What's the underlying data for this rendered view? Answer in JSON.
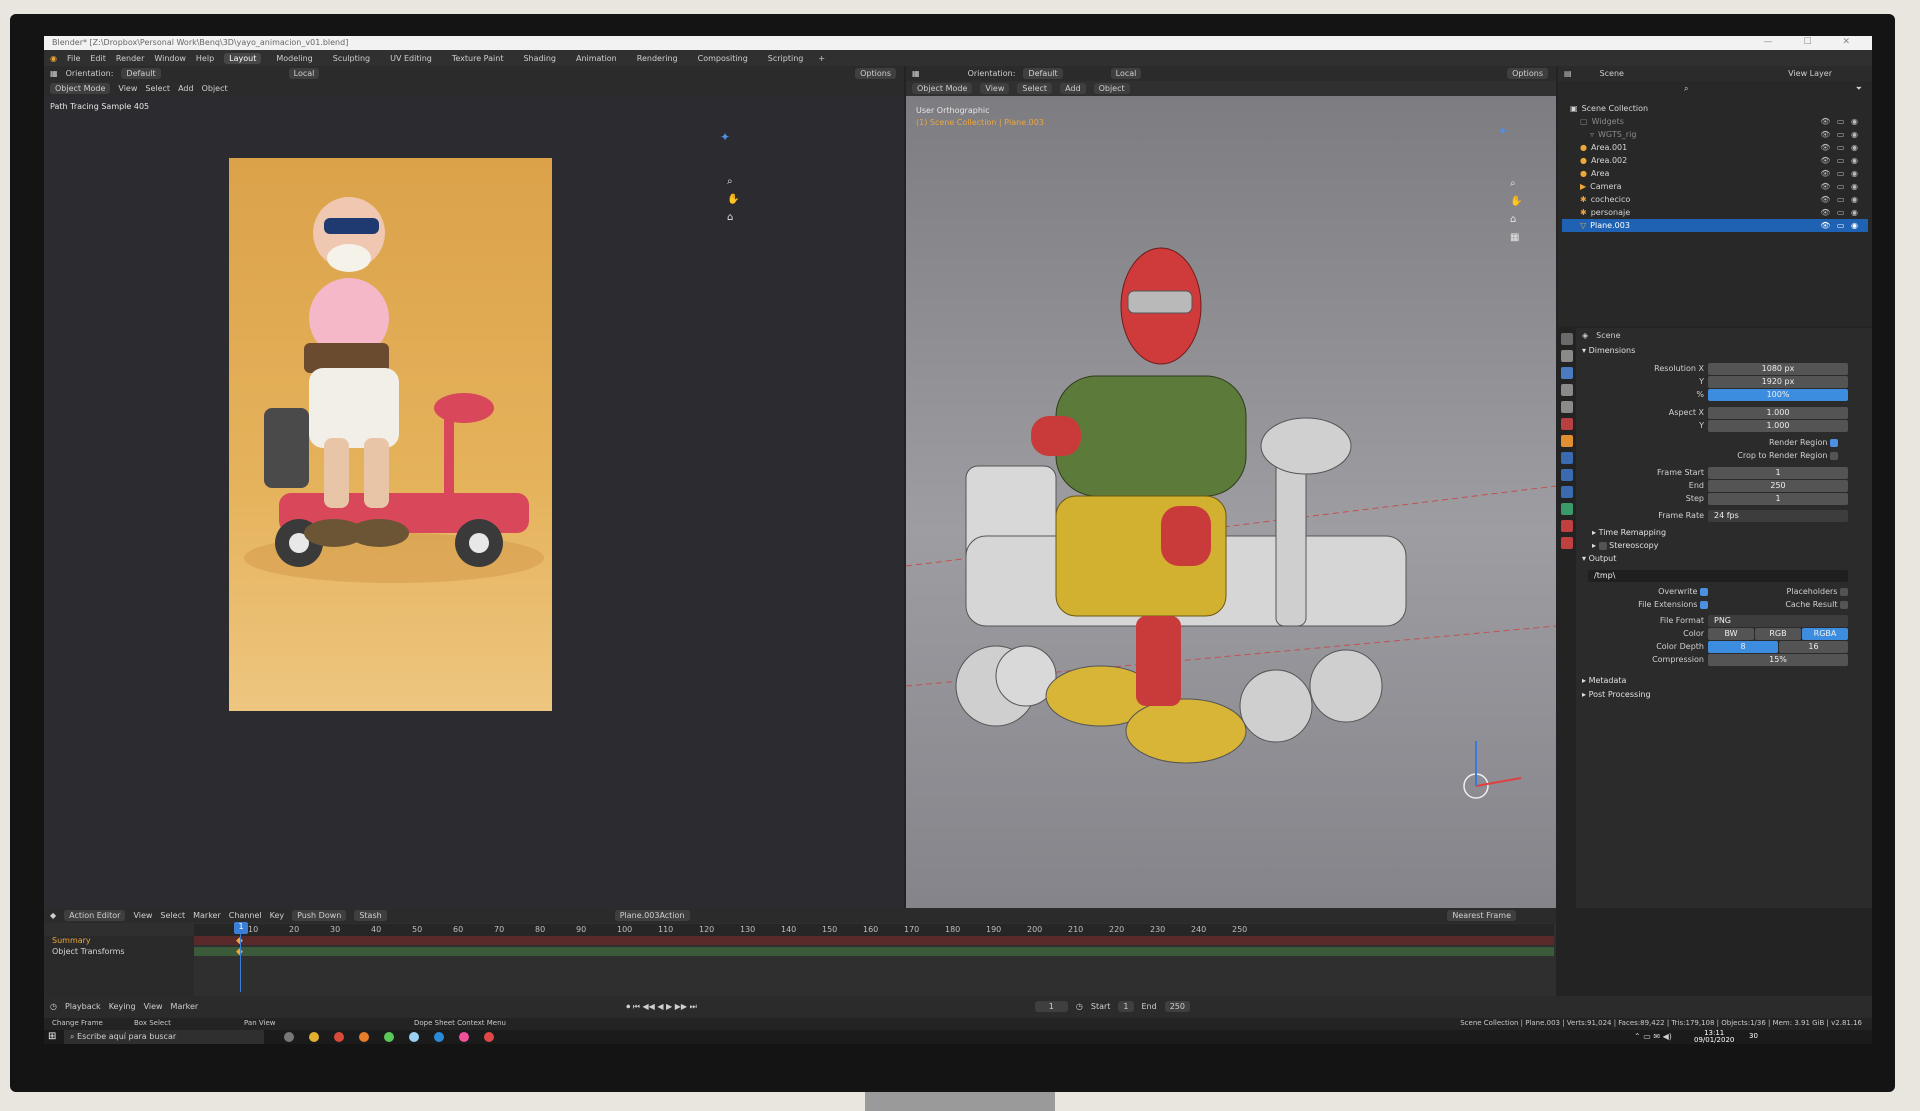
{
  "titlebar": {
    "text": "Blender* [Z:\\Dropbox\\Personal Work\\Benq\\3D\\yayo_animacion_v01.blend]"
  },
  "menu": [
    "File",
    "Edit",
    "Render",
    "Window",
    "Help"
  ],
  "workspaces": [
    "Layout",
    "Modeling",
    "Sculpting",
    "UV Editing",
    "Texture Paint",
    "Shading",
    "Animation",
    "Rendering",
    "Compositing",
    "Scripting"
  ],
  "active_workspace": "Layout",
  "render_view": {
    "orientation_label": "Orientation:",
    "orientation_value": "Default",
    "pivot": "Local",
    "options": "Options",
    "mode": "Object Mode",
    "menus": [
      "View",
      "Select",
      "Add",
      "Object"
    ],
    "sample_text": "Path Tracing Sample 405"
  },
  "viewport": {
    "mode": "Object Mode",
    "menus": [
      "View",
      "Select",
      "Add",
      "Object"
    ],
    "orientation_label": "Orientation:",
    "orientation_value": "Default",
    "pivot": "Local",
    "options": "Options",
    "view_name": "User Orthographic",
    "collection_path": "(1) Scene Collection | Plane.003"
  },
  "outliner": {
    "scene_label": "Scene",
    "view_layer_label": "View Layer",
    "rows": [
      {
        "label": "Scene Collection",
        "selected": false,
        "indent": 0
      },
      {
        "label": "Widgets",
        "selected": false,
        "indent": 1
      },
      {
        "label": "WGTS_rig",
        "selected": false,
        "indent": 2
      },
      {
        "label": "Area.001",
        "selected": false,
        "indent": 1
      },
      {
        "label": "Area.002",
        "selected": false,
        "indent": 1
      },
      {
        "label": "Area",
        "selected": false,
        "indent": 1
      },
      {
        "label": "Camera",
        "selected": false,
        "indent": 1
      },
      {
        "label": "cochecico",
        "selected": false,
        "indent": 1
      },
      {
        "label": "personaje",
        "selected": false,
        "indent": 1
      },
      {
        "label": "Plane.003",
        "selected": true,
        "indent": 1
      }
    ]
  },
  "properties": {
    "scene_label": "Scene",
    "dimensions": "Dimensions",
    "resolution_x_label": "Resolution X",
    "resolution_x": "1080 px",
    "resolution_y_label": "Y",
    "resolution_y": "1920 px",
    "percent_label": "%",
    "percent": "100%",
    "aspect_x_label": "Aspect X",
    "aspect_x": "1.000",
    "aspect_y_label": "Y",
    "aspect_y": "1.000",
    "render_region": "Render Region",
    "crop_region": "Crop to Render Region",
    "frame_start_label": "Frame Start",
    "frame_start": "1",
    "frame_end_label": "End",
    "frame_end": "250",
    "frame_step_label": "Step",
    "frame_step": "1",
    "frame_rate_label": "Frame Rate",
    "frame_rate": "24 fps",
    "time_remapping": "Time Remapping",
    "stereoscopy": "Stereoscopy",
    "output": "Output",
    "output_path": "/tmp\\",
    "overwrite": "Overwrite",
    "placeholders": "Placeholders",
    "file_extensions": "File Extensions",
    "cache_result": "Cache Result",
    "file_format_label": "File Format",
    "file_format": "PNG",
    "color_label": "Color",
    "color_options": [
      "BW",
      "RGB",
      "RGBA"
    ],
    "color_depth_label": "Color Depth",
    "color_depth_options": [
      "8",
      "16"
    ],
    "compression_label": "Compression",
    "compression": "15%",
    "metadata": "Metadata",
    "post_processing": "Post Processing"
  },
  "dopesheet": {
    "editor": "Action Editor",
    "menus": [
      "View",
      "Select",
      "Marker",
      "Channel",
      "Key"
    ],
    "push_down": "Push Down",
    "stash": "Stash",
    "action_name": "Plane.003Action",
    "snap": "Nearest Frame",
    "current_frame": "1",
    "ticks": [
      "10",
      "20",
      "30",
      "40",
      "50",
      "60",
      "70",
      "80",
      "90",
      "100",
      "110",
      "120",
      "130",
      "140",
      "150",
      "160",
      "170",
      "180",
      "190",
      "200",
      "210",
      "220",
      "230",
      "240",
      "250"
    ],
    "channels": [
      "Summary",
      "Object Transforms"
    ]
  },
  "timeline": {
    "menus": [
      "Playback",
      "Keying",
      "View",
      "Marker"
    ],
    "current_frame": "1",
    "start_label": "Start",
    "start": "1",
    "end_label": "End",
    "end": "250"
  },
  "statusbar": {
    "left": [
      "Change Frame",
      "Box Select",
      "Pan View",
      "Dope Sheet Context Menu"
    ],
    "right": "Scene Collection | Plane.003 | Verts:91,024 | Faces:89,422 | Tris:179,108 | Objects:1/36 | Mem: 3.91 GiB | v2.81.16"
  },
  "taskbar": {
    "search": "Escribe aquí para buscar",
    "time": "13:11",
    "date": "09/01/2020",
    "notification_count": "30"
  }
}
